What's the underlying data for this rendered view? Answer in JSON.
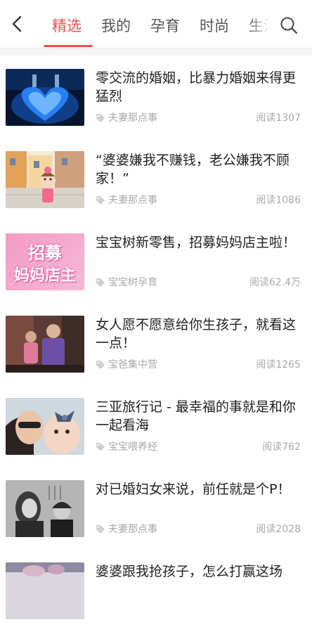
{
  "header": {
    "tabs": [
      {
        "label": "精选",
        "active": true
      },
      {
        "label": "我的",
        "active": false
      },
      {
        "label": "孕育",
        "active": false
      },
      {
        "label": "时尚",
        "active": false
      },
      {
        "label": "生活",
        "active": false
      }
    ],
    "back_icon": "chevron-left-icon",
    "search_icon": "search-icon",
    "accent_color": "#e8534f"
  },
  "feed": {
    "items": [
      {
        "title": "零交流的婚姻，比暴力婚姻来得更猛烈",
        "source": "夫妻那点事",
        "reads": "阅读1307"
      },
      {
        "title": "“婆婆嫌我不赚钱，老公嫌我不顾家！”",
        "source": "夫妻那点事",
        "reads": "阅读1086"
      },
      {
        "title": "宝宝树新零售，招募妈妈店主啦！",
        "source": "宝宝树孕育",
        "reads": "阅读62.4万",
        "thumb_text_1": "招募",
        "thumb_text_2": "妈妈店主"
      },
      {
        "title": "女人愿不愿意给你生孩子，就看这一点！",
        "source": "宝爸集中营",
        "reads": "阅读1265"
      },
      {
        "title": "三亚旅行记 - 最幸福的事就是和你一起看海",
        "source": "宝宝喂养经",
        "reads": "阅读762"
      },
      {
        "title": "对已婚妇女来说，前任就是个P！",
        "source": "夫妻那点事",
        "reads": "阅读2028"
      },
      {
        "title": "婆婆跟我抢孩子，怎么打赢这场",
        "source": "",
        "reads": ""
      }
    ]
  }
}
